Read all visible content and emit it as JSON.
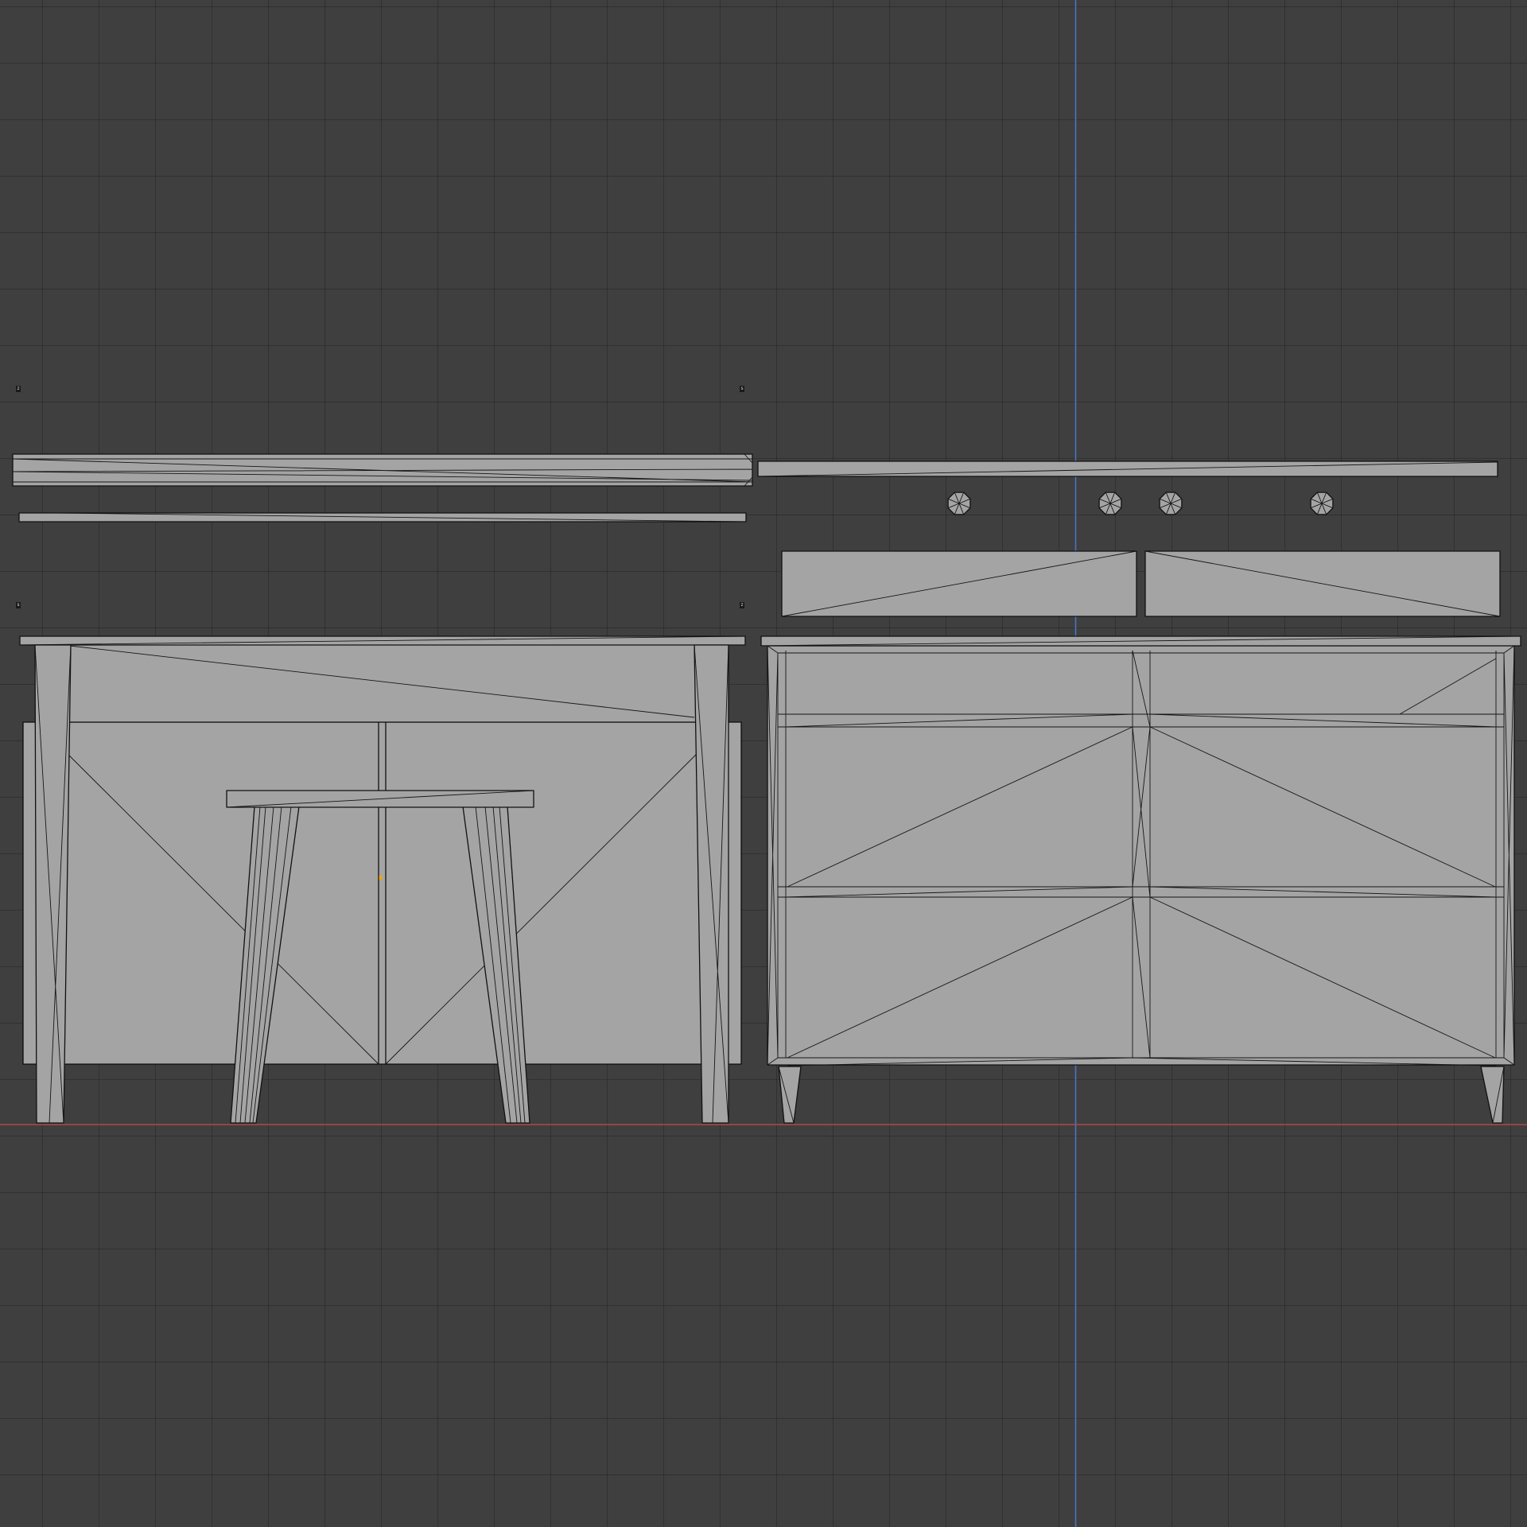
{
  "viewport": {
    "mode": "orthographic-front",
    "grid": true,
    "colors": {
      "background": "#3f3f3f",
      "grid": "#333333",
      "mesh_fill": "#a4a4a4",
      "mesh_edge": "#111111",
      "x_axis": "#b04848",
      "z_axis": "#4a74c8",
      "origin": "#e9a800"
    }
  },
  "corner_labels": [
    "z",
    "s",
    "s",
    "z"
  ],
  "objects": [
    "desk-top-strip",
    "desk-side-strip",
    "cabinet-top-strip",
    "knob-1",
    "knob-2",
    "knob-3",
    "knob-4",
    "drawer-front-left",
    "drawer-front-right",
    "desk-front",
    "stool-front",
    "dresser-front"
  ]
}
